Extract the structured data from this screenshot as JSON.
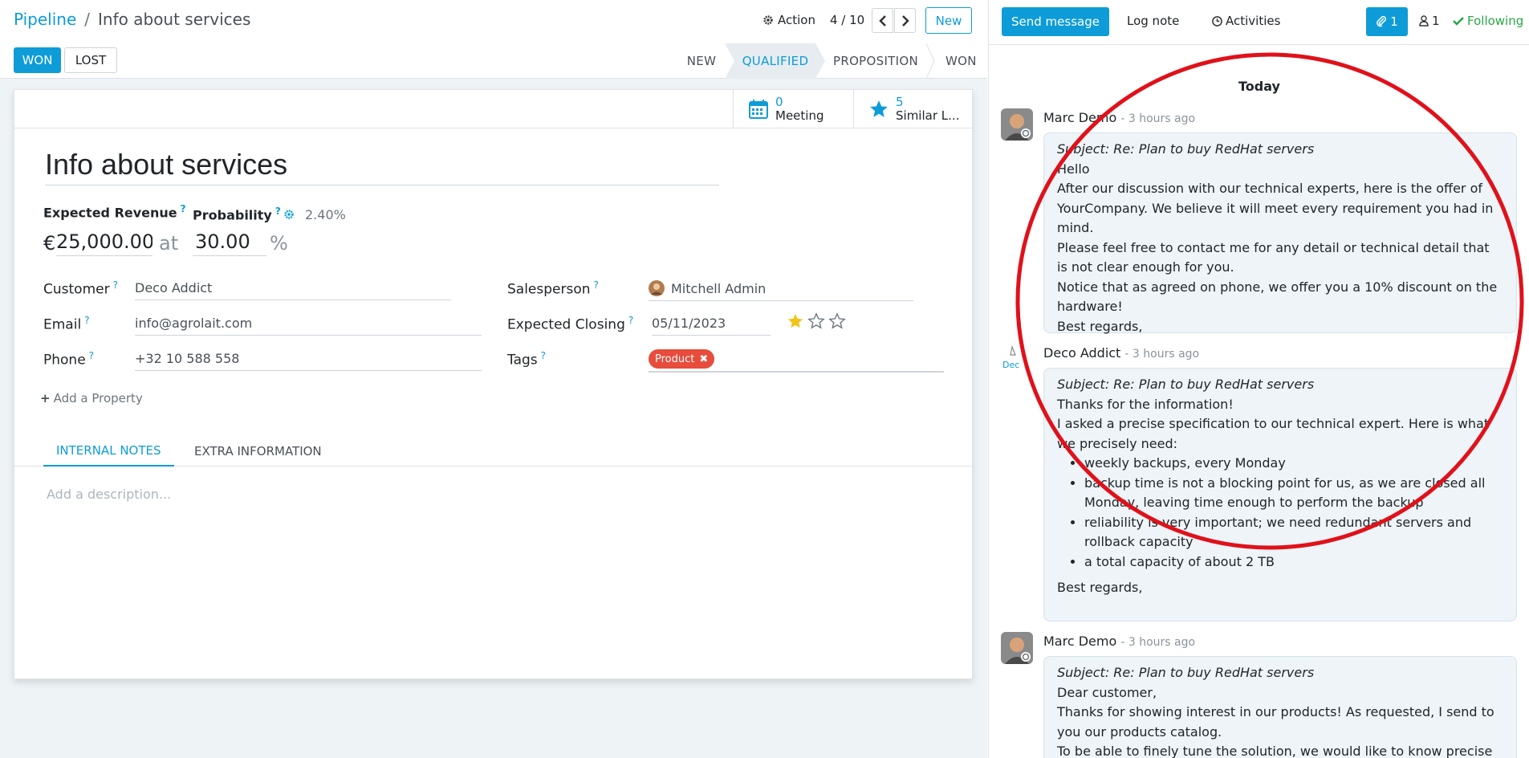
{
  "breadcrumb": {
    "parent": "Pipeline",
    "separator": "/",
    "current": "Info about services"
  },
  "control": {
    "action_label": "Action",
    "pager": "4 / 10",
    "new_label": "New"
  },
  "status": {
    "won_label": "WON",
    "lost_label": "LOST",
    "stages": [
      "NEW",
      "QUALIFIED",
      "PROPOSITION",
      "WON"
    ],
    "active_stage": "QUALIFIED"
  },
  "smart_buttons": [
    {
      "count": "0",
      "label": "Meeting",
      "icon": "calendar-icon"
    },
    {
      "count": "5",
      "label": "Similar L...",
      "icon": "star-icon"
    }
  ],
  "form": {
    "title": "Info about services",
    "expected_revenue_label": "Expected Revenue",
    "probability_label": "Probability",
    "auto_probability": "2.40%",
    "currency": "€",
    "revenue": "25,000.00",
    "at": "at",
    "probability": "30.00",
    "percent": "%",
    "customer_label": "Customer",
    "customer": "Deco Addict",
    "email_label": "Email",
    "email": "info@agrolait.com",
    "phone_label": "Phone",
    "phone": "+32 10 588 558",
    "salesperson_label": "Salesperson",
    "salesperson": "Mitchell Admin",
    "closing_label": "Expected Closing",
    "closing": "05/11/2023",
    "priority_stars": 1,
    "tags_label": "Tags",
    "tag": "Product",
    "add_property": "Add a Property",
    "tabs": [
      "INTERNAL NOTES",
      "EXTRA INFORMATION"
    ],
    "description_placeholder": "Add a description..."
  },
  "chatter": {
    "send_message": "Send message",
    "log_note": "Log note",
    "activities": "Activities",
    "attachments": "1",
    "followers": "1",
    "following": "Following",
    "day": "Today",
    "messages": [
      {
        "author": "Marc Demo",
        "date": "- 3 hours ago",
        "subject": "Subject: Re: Plan to buy RedHat servers",
        "lines": [
          "Hello",
          "After our discussion with our technical experts, here is the offer of YourCompany. We believe it will meet every requirement you had in mind.",
          "Please feel free to contact me for any detail or technical detail that is not clear enough for you.",
          "Notice that as agreed on phone, we offer you a 10% discount on the hardware!",
          "Best regards,"
        ]
      },
      {
        "author": "Deco Addict",
        "date": "- 3 hours ago",
        "subject": "Subject: Re: Plan to buy RedHat servers",
        "lines": [
          "Thanks for the information!",
          "I asked a precise specification to our technical expert. Here is what we precisely need:"
        ],
        "bullets": [
          "weekly backups, every Monday",
          "backup time is not a blocking point for us, as we are closed all Monday, leaving time enough to perform the backup",
          "reliability is very important; we need redundant servers and rollback capacity",
          "a total capacity of about 2 TB"
        ],
        "closing": "Best regards,"
      },
      {
        "author": "Marc Demo",
        "date": "- 3 hours ago",
        "subject": "Subject: Re: Plan to buy RedHat servers",
        "lines": [
          "Dear customer,",
          "Thanks for showing interest in our products! As requested, I send to you our products catalog.",
          "To be able to finely tune the solution, we would like to know precise"
        ]
      }
    ]
  },
  "colors": {
    "accent": "#0d9cd8",
    "annotation": "#e0111a",
    "tag": "#e74c3c",
    "star": "#f3c316"
  }
}
